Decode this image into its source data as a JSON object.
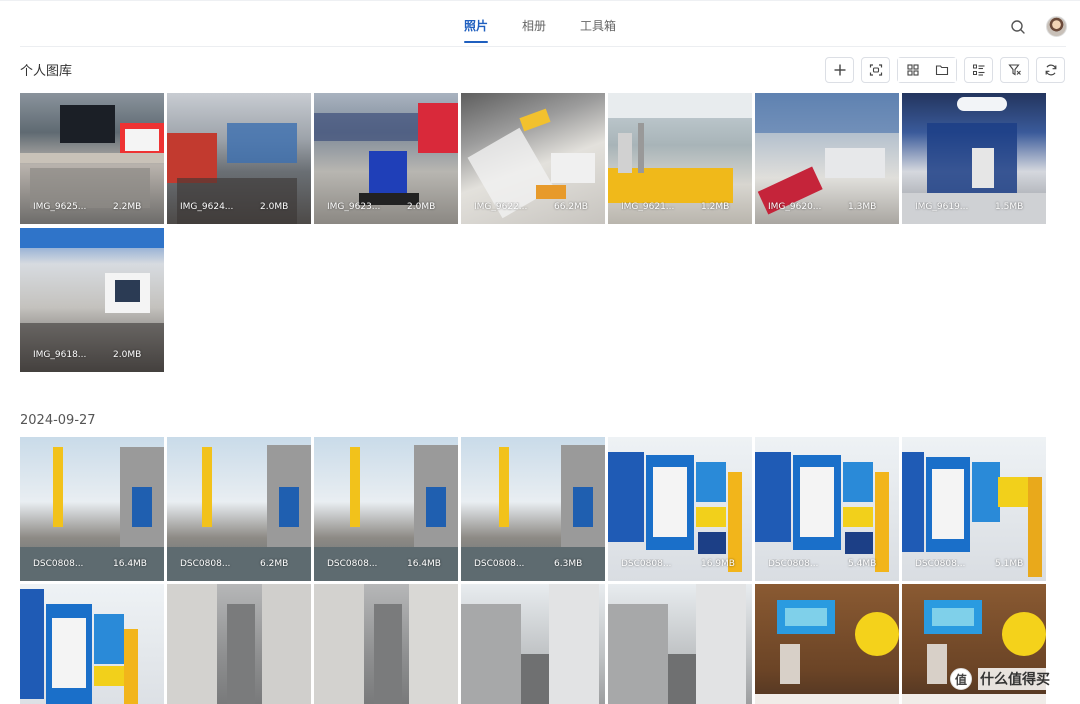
{
  "nav": {
    "tabs": [
      {
        "label": "照片",
        "active": true
      },
      {
        "label": "相册",
        "active": false
      },
      {
        "label": "工具箱",
        "active": false
      }
    ],
    "search_icon": "search-icon",
    "avatar_icon": "user-avatar"
  },
  "header": {
    "title": "个人图库",
    "toolbar": [
      {
        "icon": "plus-icon"
      },
      {
        "icon": "face-scan-icon"
      },
      {
        "icon": "grid-view-icon"
      },
      {
        "icon": "folder-view-icon"
      },
      {
        "icon": "list-sort-icon"
      },
      {
        "icon": "filter-icon"
      },
      {
        "icon": "refresh-icon"
      }
    ]
  },
  "group1": {
    "photos": [
      {
        "name": "IMG_9625...",
        "size": "2.2MB"
      },
      {
        "name": "IMG_9624...",
        "size": "2.0MB"
      },
      {
        "name": "IMG_9623...",
        "size": "2.0MB"
      },
      {
        "name": "IMG_9622...",
        "size": "66.2MB"
      },
      {
        "name": "IMG_9621...",
        "size": "1.2MB"
      },
      {
        "name": "IMG_9620...",
        "size": "1.3MB"
      },
      {
        "name": "IMG_9619...",
        "size": "1.5MB"
      },
      {
        "name": "IMG_9618...",
        "size": "2.0MB"
      }
    ]
  },
  "group2": {
    "date": "2024-09-27",
    "photos": [
      {
        "name": "DSC0808...",
        "size": "16.4MB"
      },
      {
        "name": "DSC0808...",
        "size": "6.2MB"
      },
      {
        "name": "DSC0808...",
        "size": "16.4MB"
      },
      {
        "name": "DSC0808...",
        "size": "6.3MB"
      },
      {
        "name": "DSC0808...",
        "size": "16.9MB"
      },
      {
        "name": "DSC0808...",
        "size": "5.4MB"
      },
      {
        "name": "DSC0808...",
        "size": "5.1MB"
      }
    ]
  },
  "watermark": {
    "logo": "值",
    "text": "什么值得买"
  },
  "colors": {
    "accent": "#1f5fbf",
    "border": "#dcdfe5"
  }
}
